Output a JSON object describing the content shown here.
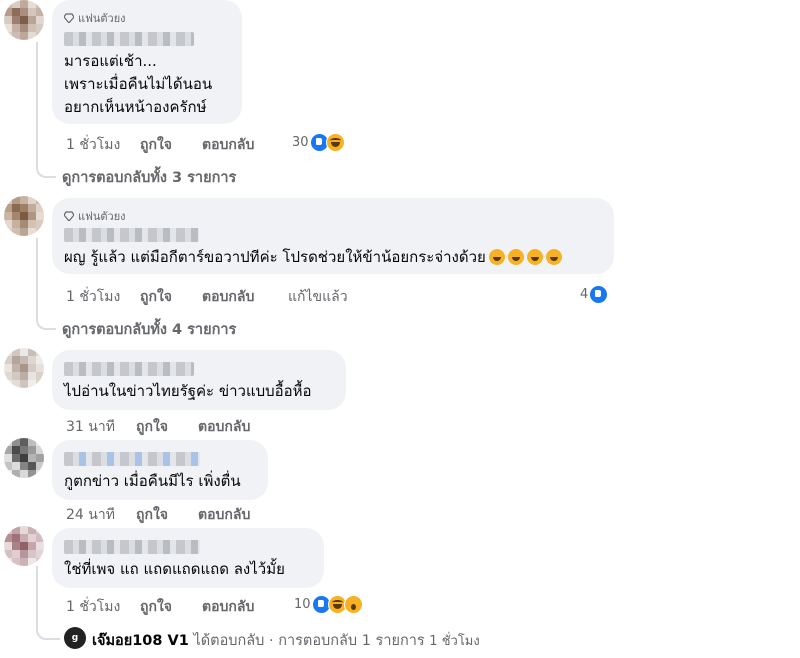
{
  "comments": [
    {
      "badge": "แฟนตัวยง",
      "lines": [
        "มารอแต่เช้า...",
        "เพราะเมื่อคืนไม่ได้นอน",
        "อยากเห็นหน้าองครักษ์"
      ],
      "time": "1 ชั่วโมง",
      "like": "ถูกใจ",
      "reply": "ตอบกลับ",
      "reaction_count": "30",
      "reactions": [
        "like-icon",
        "haha-icon"
      ],
      "view_replies": "ดูการตอบกลับทั้ง 3 รายการ"
    },
    {
      "badge": "แฟนตัวยง",
      "lines": [
        "ผญ รู้แล้ว แต่มือกีตาร์ขอวาปทีค่ะ โปรดช่วยให้ข้าน้อยกระจ่างด้วย"
      ],
      "time": "1 ชั่วโมง",
      "like": "ถูกใจ",
      "reply": "ตอบกลับ",
      "edited": "แก้ไขแล้ว",
      "reaction_count": "4",
      "reactions": [
        "like-icon"
      ],
      "emoji": [
        "rofl-emoji",
        "rofl-emoji",
        "rofl-emoji",
        "rofl-emoji"
      ],
      "view_replies": "ดูการตอบกลับทั้ง 4 รายการ"
    },
    {
      "lines": [
        "ไปอ่านในข่าวไทยรัฐค่ะ ข่าวแบบอื้อหื้อ"
      ],
      "time": "31 นาที",
      "like": "ถูกใจ",
      "reply": "ตอบกลับ"
    },
    {
      "lines": [
        "กูตกข่าว เมื่อคืนมีไร เพิ่งตื่น"
      ],
      "time": "24 นาที",
      "like": "ถูกใจ",
      "reply": "ตอบกลับ"
    },
    {
      "lines": [
        "ใช่ที่เพจ แถ แถดแถดแถด ลงไว้มั้ย"
      ],
      "time": "1 ชั่วโมง",
      "like": "ถูกใจ",
      "reply": "ตอบกลับ",
      "reaction_count": "10",
      "reactions": [
        "like-icon",
        "haha-icon",
        "wow-icon"
      ]
    }
  ],
  "reply_summary": {
    "avatar_text": "g",
    "name": "เจ๊มอย108 V1",
    "action": "ได้ตอบกลับ · การตอบกลับ 1 รายการ",
    "time": "1 ชั่วโมง"
  },
  "colors": {
    "bubble": "#f0f2f5",
    "meta": "#65676b",
    "like": "#1877f2",
    "haha": "#f7b125"
  }
}
